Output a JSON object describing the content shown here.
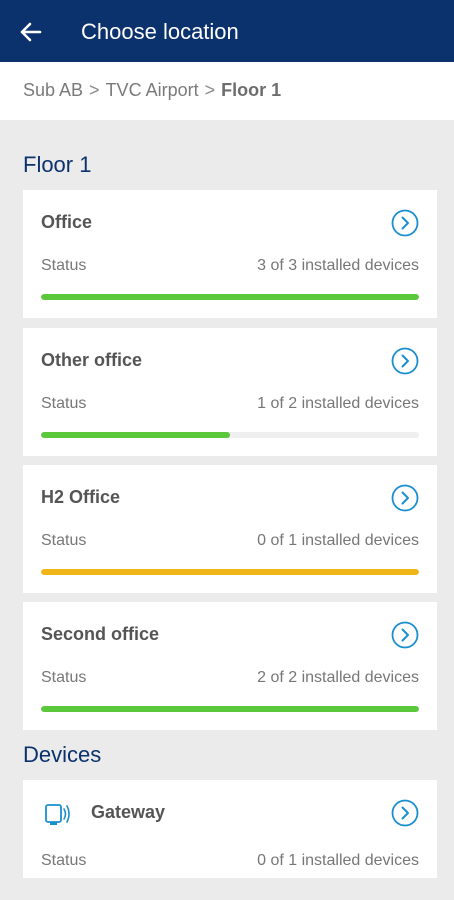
{
  "header": {
    "title": "Choose location",
    "back_icon": "arrow-left-icon"
  },
  "breadcrumb": {
    "items": [
      "Sub AB",
      "TVC Airport",
      "Floor 1"
    ],
    "separator": ">"
  },
  "sections": {
    "locations_heading": "Floor 1",
    "devices_heading": "Devices"
  },
  "colors": {
    "header_bg": "#0b326c",
    "accent_blue": "#1a8fd0",
    "progress_green": "#5ac83a",
    "progress_yellow": "#f0b619",
    "progress_track": "#efefef"
  },
  "locations": [
    {
      "name": "Office",
      "status_label": "Status",
      "status_text": "3 of 3 installed devices",
      "progress": 1.0,
      "bar_color": "#5ac83a"
    },
    {
      "name": "Other office",
      "status_label": "Status",
      "status_text": "1 of 2 installed devices",
      "progress": 0.5,
      "bar_color": "#5ac83a"
    },
    {
      "name": "H2 Office",
      "status_label": "Status",
      "status_text": "0 of 1 installed devices",
      "progress": 1.0,
      "bar_color": "#f0b619"
    },
    {
      "name": "Second office",
      "status_label": "Status",
      "status_text": "2 of 2 installed devices",
      "progress": 1.0,
      "bar_color": "#5ac83a"
    }
  ],
  "devices": [
    {
      "name": "Gateway",
      "icon": "gateway-icon",
      "status_label": "Status",
      "status_text": "0 of 1 installed devices"
    }
  ]
}
